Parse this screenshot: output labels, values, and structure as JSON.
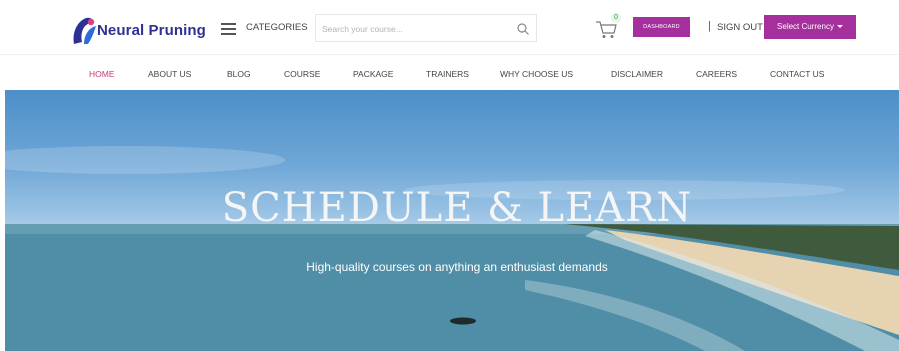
{
  "header": {
    "logo_text": "Neural Pruning",
    "categories_label": "CATEGORIES",
    "search_placeholder": "Search your course...",
    "cart_count": "0",
    "dashboard_label": "DASHBOARD",
    "separator": "|",
    "signout_label": "SIGN OUT",
    "currency_label": "Select Currency",
    "accent_color": "#a52f9d"
  },
  "nav": {
    "items": [
      {
        "label": "HOME",
        "active": true
      },
      {
        "label": "ABOUT US"
      },
      {
        "label": "BLOG"
      },
      {
        "label": "COURSE"
      },
      {
        "label": "PACKAGE"
      },
      {
        "label": "TRAINERS"
      },
      {
        "label": "WHY CHOOSE US"
      },
      {
        "label": "DISCLAIMER"
      },
      {
        "label": "CAREERS"
      },
      {
        "label": "CONTACT US"
      }
    ]
  },
  "hero": {
    "title": "SCHEDULE & LEARN",
    "subtitle": "High-quality courses on anything an enthusiast demands"
  }
}
